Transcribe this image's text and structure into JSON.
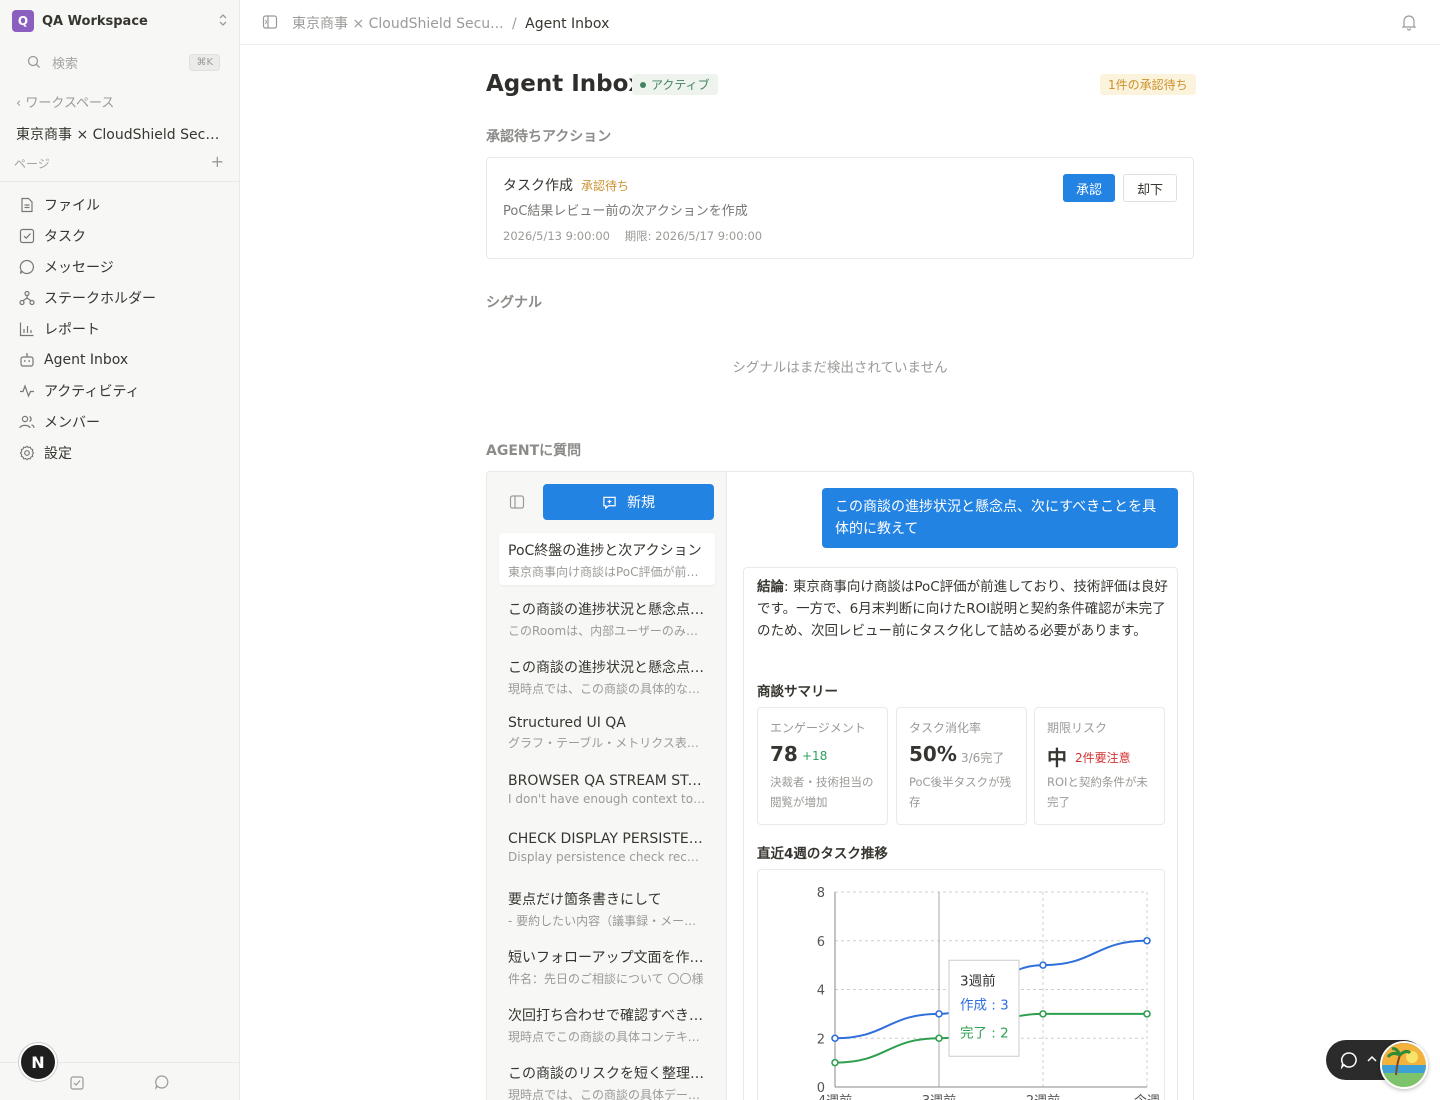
{
  "workspace": {
    "logo_letter": "Q",
    "name": "QA Workspace"
  },
  "sidebar": {
    "search_placeholder": "検索",
    "search_shortcut": "⌘K",
    "back_label": "ワークスペース",
    "room_title": "東京商事 × CloudShield Security",
    "pages_label": "ページ",
    "items": [
      {
        "label": "ファイル",
        "icon": "file-icon"
      },
      {
        "label": "タスク",
        "icon": "task-icon"
      },
      {
        "label": "メッセージ",
        "icon": "message-icon"
      },
      {
        "label": "ステークホルダー",
        "icon": "stakeholder-icon"
      },
      {
        "label": "レポート",
        "icon": "report-icon"
      },
      {
        "label": "Agent Inbox",
        "icon": "inbox-icon"
      },
      {
        "label": "アクティビティ",
        "icon": "activity-icon"
      },
      {
        "label": "メンバー",
        "icon": "members-icon"
      },
      {
        "label": "設定",
        "icon": "settings-icon"
      }
    ],
    "user_initial": "N"
  },
  "topbar": {
    "crumb_parent": "東京商事 × CloudShield Secu...",
    "crumb_sep": "/",
    "crumb_current": "Agent Inbox"
  },
  "page": {
    "title": "Agent Inbox",
    "status": "アクティブ",
    "pending_count": "1件の承認待ち",
    "pending_section": "承認待ちアクション",
    "signal_section": "シグナル",
    "signal_empty": "シグナルはまだ検出されていません",
    "agent_section": "AGENTに質問"
  },
  "action": {
    "title": "タスク作成",
    "status": "承認待ち",
    "description": "PoC結果レビュー前の次アクションを作成",
    "created": "2026/5/13 9:00:00",
    "due": "期限: 2026/5/17 9:00:00",
    "approve_label": "承認",
    "reject_label": "却下"
  },
  "agent": {
    "new_label": "新規",
    "conversations": [
      {
        "title": "PoC終盤の進捗と次アクション",
        "snippet": "東京商事向け商談はPoC評価が前進しており"
      },
      {
        "title": "この商談の進捗状況と懸念点、次にすべきこと",
        "snippet": "このRoomは、内部ユーザーのみで構成されています"
      },
      {
        "title": "この商談の進捗状況と懸念点、次にすべきこと",
        "snippet": "現時点では、この商談の具体的な情報が不足しています"
      },
      {
        "title": "Structured UI QA",
        "snippet": "グラフ・テーブル・メトリクス表示の確認"
      },
      {
        "title": "BROWSER QA STREAM START",
        "snippet": "I don't have enough context to infer"
      },
      {
        "title": "CHECK DISPLAY PERSISTENCE",
        "snippet": "Display persistence check received"
      },
      {
        "title": "要点だけ箇条書きにして",
        "snippet": "- 要約したい内容（議事録・メールなど）"
      },
      {
        "title": "短いフォローアップ文面を作成して",
        "snippet": "件名：先日のご相談について 〇〇様"
      },
      {
        "title": "次回打ち合わせで確認すべきこと",
        "snippet": "現時点でこの商談の具体コンテキストが"
      },
      {
        "title": "この商談のリスクを短く整理して",
        "snippet": "現時点では、この商談の具体データが"
      }
    ],
    "user_message": "この商談の進捗状況と懸念点、次にすべきことを具体的に教えて",
    "conclusion_label": "結論",
    "conclusion_text": ": 東京商事向け商談はPoC評価が前進しており、技術評価は良好です。一方で、6月末判断に向けたROI説明と契約条件確認が未完了のため、次回レビュー前にタスク化して詰める必要があります。",
    "summary_title": "商談サマリー",
    "metrics": [
      {
        "label": "エンゲージメント",
        "value": "78",
        "delta": "+18",
        "delta_color": "#2e9f5a",
        "note": "決裁者・技術担当の閲覧が増加"
      },
      {
        "label": "タスク消化率",
        "value": "50%",
        "delta": "3/6完了",
        "delta_color": "#9b9a97",
        "note": "PoC後半タスクが残存"
      },
      {
        "label": "期限リスク",
        "value": "中",
        "delta": "2件要注意",
        "delta_color": "#d1312e",
        "note": "ROIと契約条件が未完了"
      }
    ],
    "trend_title": "直近4週のタスク推移"
  },
  "chart_data": {
    "type": "line",
    "categories": [
      "4週前",
      "3週前",
      "2週前",
      "今週"
    ],
    "series": [
      {
        "name": "作成",
        "values": [
          2,
          3,
          5,
          6
        ],
        "color": "#2f6fdc"
      },
      {
        "name": "完了",
        "values": [
          1,
          2,
          3,
          3
        ],
        "color": "#2e9f4f"
      }
    ],
    "ylim": [
      0,
      8
    ],
    "yticks": [
      0,
      2,
      4,
      6,
      8
    ],
    "grid": true,
    "tooltip": {
      "category": "3週前",
      "lines": [
        "作成 : 3",
        "完了 : 2"
      ]
    }
  }
}
